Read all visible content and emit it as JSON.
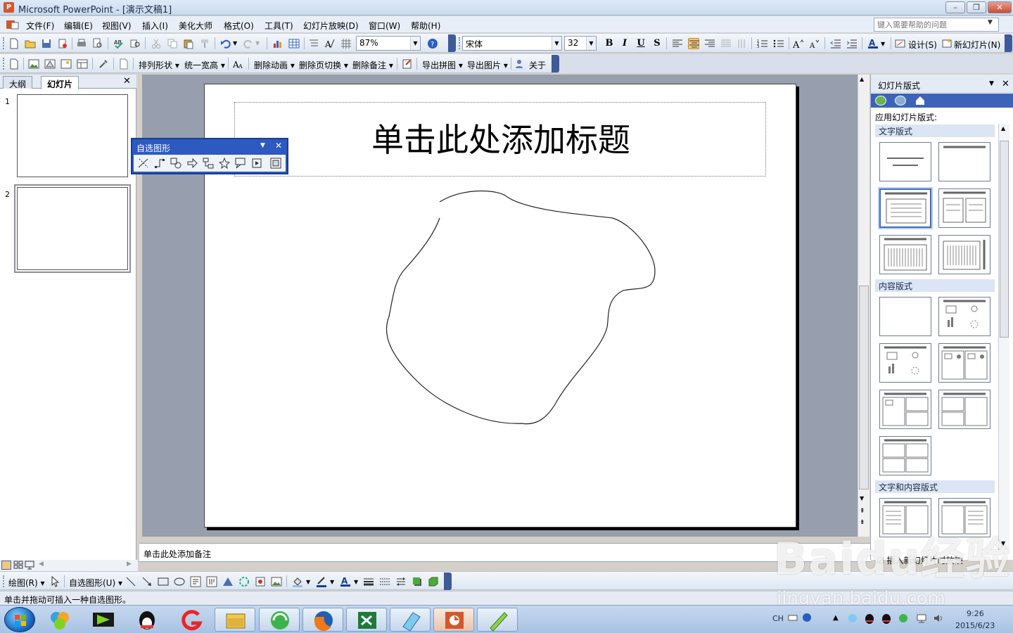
{
  "window": {
    "title": "Microsoft PowerPoint - [演示文稿1]",
    "min_label": "–",
    "max_label": "❐",
    "close_label": "✕"
  },
  "menu": {
    "items": [
      "文件(F)",
      "编辑(E)",
      "视图(V)",
      "插入(I)",
      "美化大师",
      "格式(O)",
      "工具(T)",
      "幻灯片放映(D)",
      "窗口(W)",
      "帮助(H)"
    ],
    "help_placeholder": "键入需要帮助的问题"
  },
  "standard_toolbar": {
    "zoom": "87%",
    "font": "宋体",
    "font_size": "32",
    "bold": "B",
    "italic": "I",
    "underline": "U",
    "shadow": "S",
    "design_label": "设计(S)",
    "new_slide_label": "新幻灯片(N)"
  },
  "plugin_toolbar": {
    "items": [
      "排列形状",
      "统一宽高",
      "删除动画",
      "删除页切换",
      "删除备注",
      "导出拼图",
      "导出图片",
      "关于"
    ]
  },
  "left_pane": {
    "tab_outline": "大纲",
    "tab_slides": "幻灯片",
    "close": "✕",
    "slide_numbers": [
      "1",
      "2"
    ]
  },
  "slide": {
    "title_placeholder": "单击此处添加标题"
  },
  "notes": {
    "placeholder": "单击此处添加备注"
  },
  "autoshape_toolbar": {
    "title": "自选图形"
  },
  "task_pane": {
    "title": "幻灯片版式",
    "apply_label": "应用幻灯片版式:",
    "section_text": "文字版式",
    "section_content": "内容版式",
    "section_text_content": "文字和内容版式",
    "bottom_checkbox": "插入新幻灯片时放映"
  },
  "drawing_toolbar": {
    "draw_label": "绘图(R)",
    "autoshapes_label": "自选图形(U)"
  },
  "status": {
    "text": "单击并拖动可插入一种自选图形。"
  },
  "taskbar": {
    "time": "9:26",
    "date": "2015/6/23",
    "lang": "CH"
  },
  "watermark": {
    "brand": "Baidu经验",
    "url": "jingyan.baidu.com"
  },
  "colors": {
    "accent_blue": "#3d63b8",
    "workspace_gray": "#979ead",
    "title_bar": "#dfe9f7"
  }
}
